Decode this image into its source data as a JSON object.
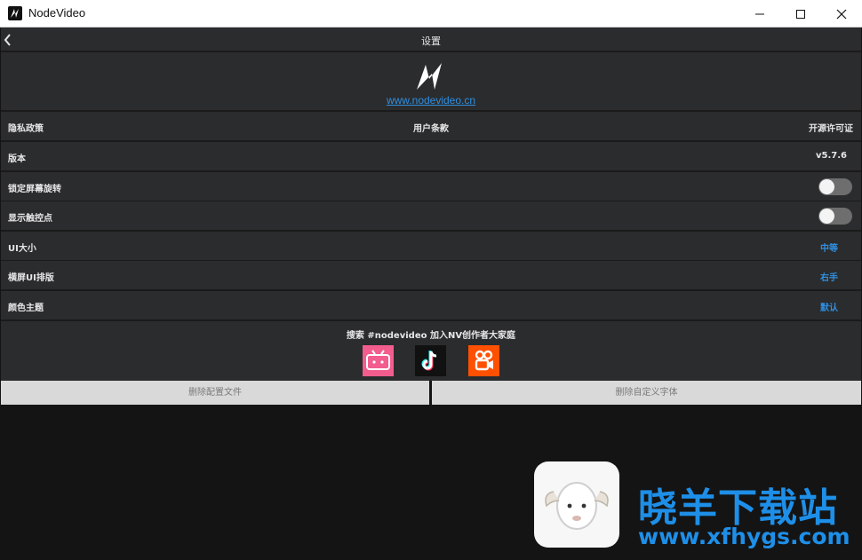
{
  "window": {
    "title": "NodeVideo"
  },
  "header": {
    "title": "设置"
  },
  "logo": {
    "link": "www.nodevideo.cn"
  },
  "links_row": {
    "privacy": "隐私政策",
    "terms": "用户条款",
    "license": "开源许可证"
  },
  "settings": [
    {
      "label": "版本",
      "value": "v5.7.6"
    },
    {
      "label": "锁定屏幕旋转",
      "toggle": false
    },
    {
      "label": "显示触控点",
      "toggle": false
    },
    {
      "label": "UI大小",
      "value": "中等"
    },
    {
      "label": "横屏UI排版",
      "value": "右手"
    },
    {
      "label": "颜色主题",
      "value": "默认"
    }
  ],
  "social": {
    "text": "搜索 #nodevideo 加入NV创作者大家庭",
    "icons": [
      "bilibili-icon",
      "tiktok-icon",
      "kuaishou-icon"
    ]
  },
  "buttons": {
    "delete_config": "删除配置文件",
    "delete_fonts": "删除自定义字体"
  },
  "watermark": {
    "text": "晓羊下载站",
    "url": "www.xfhygs.com"
  },
  "colors": {
    "accent": "#2f8fe0",
    "row_bg": "#2b2c2e",
    "page_bg": "#141414"
  }
}
